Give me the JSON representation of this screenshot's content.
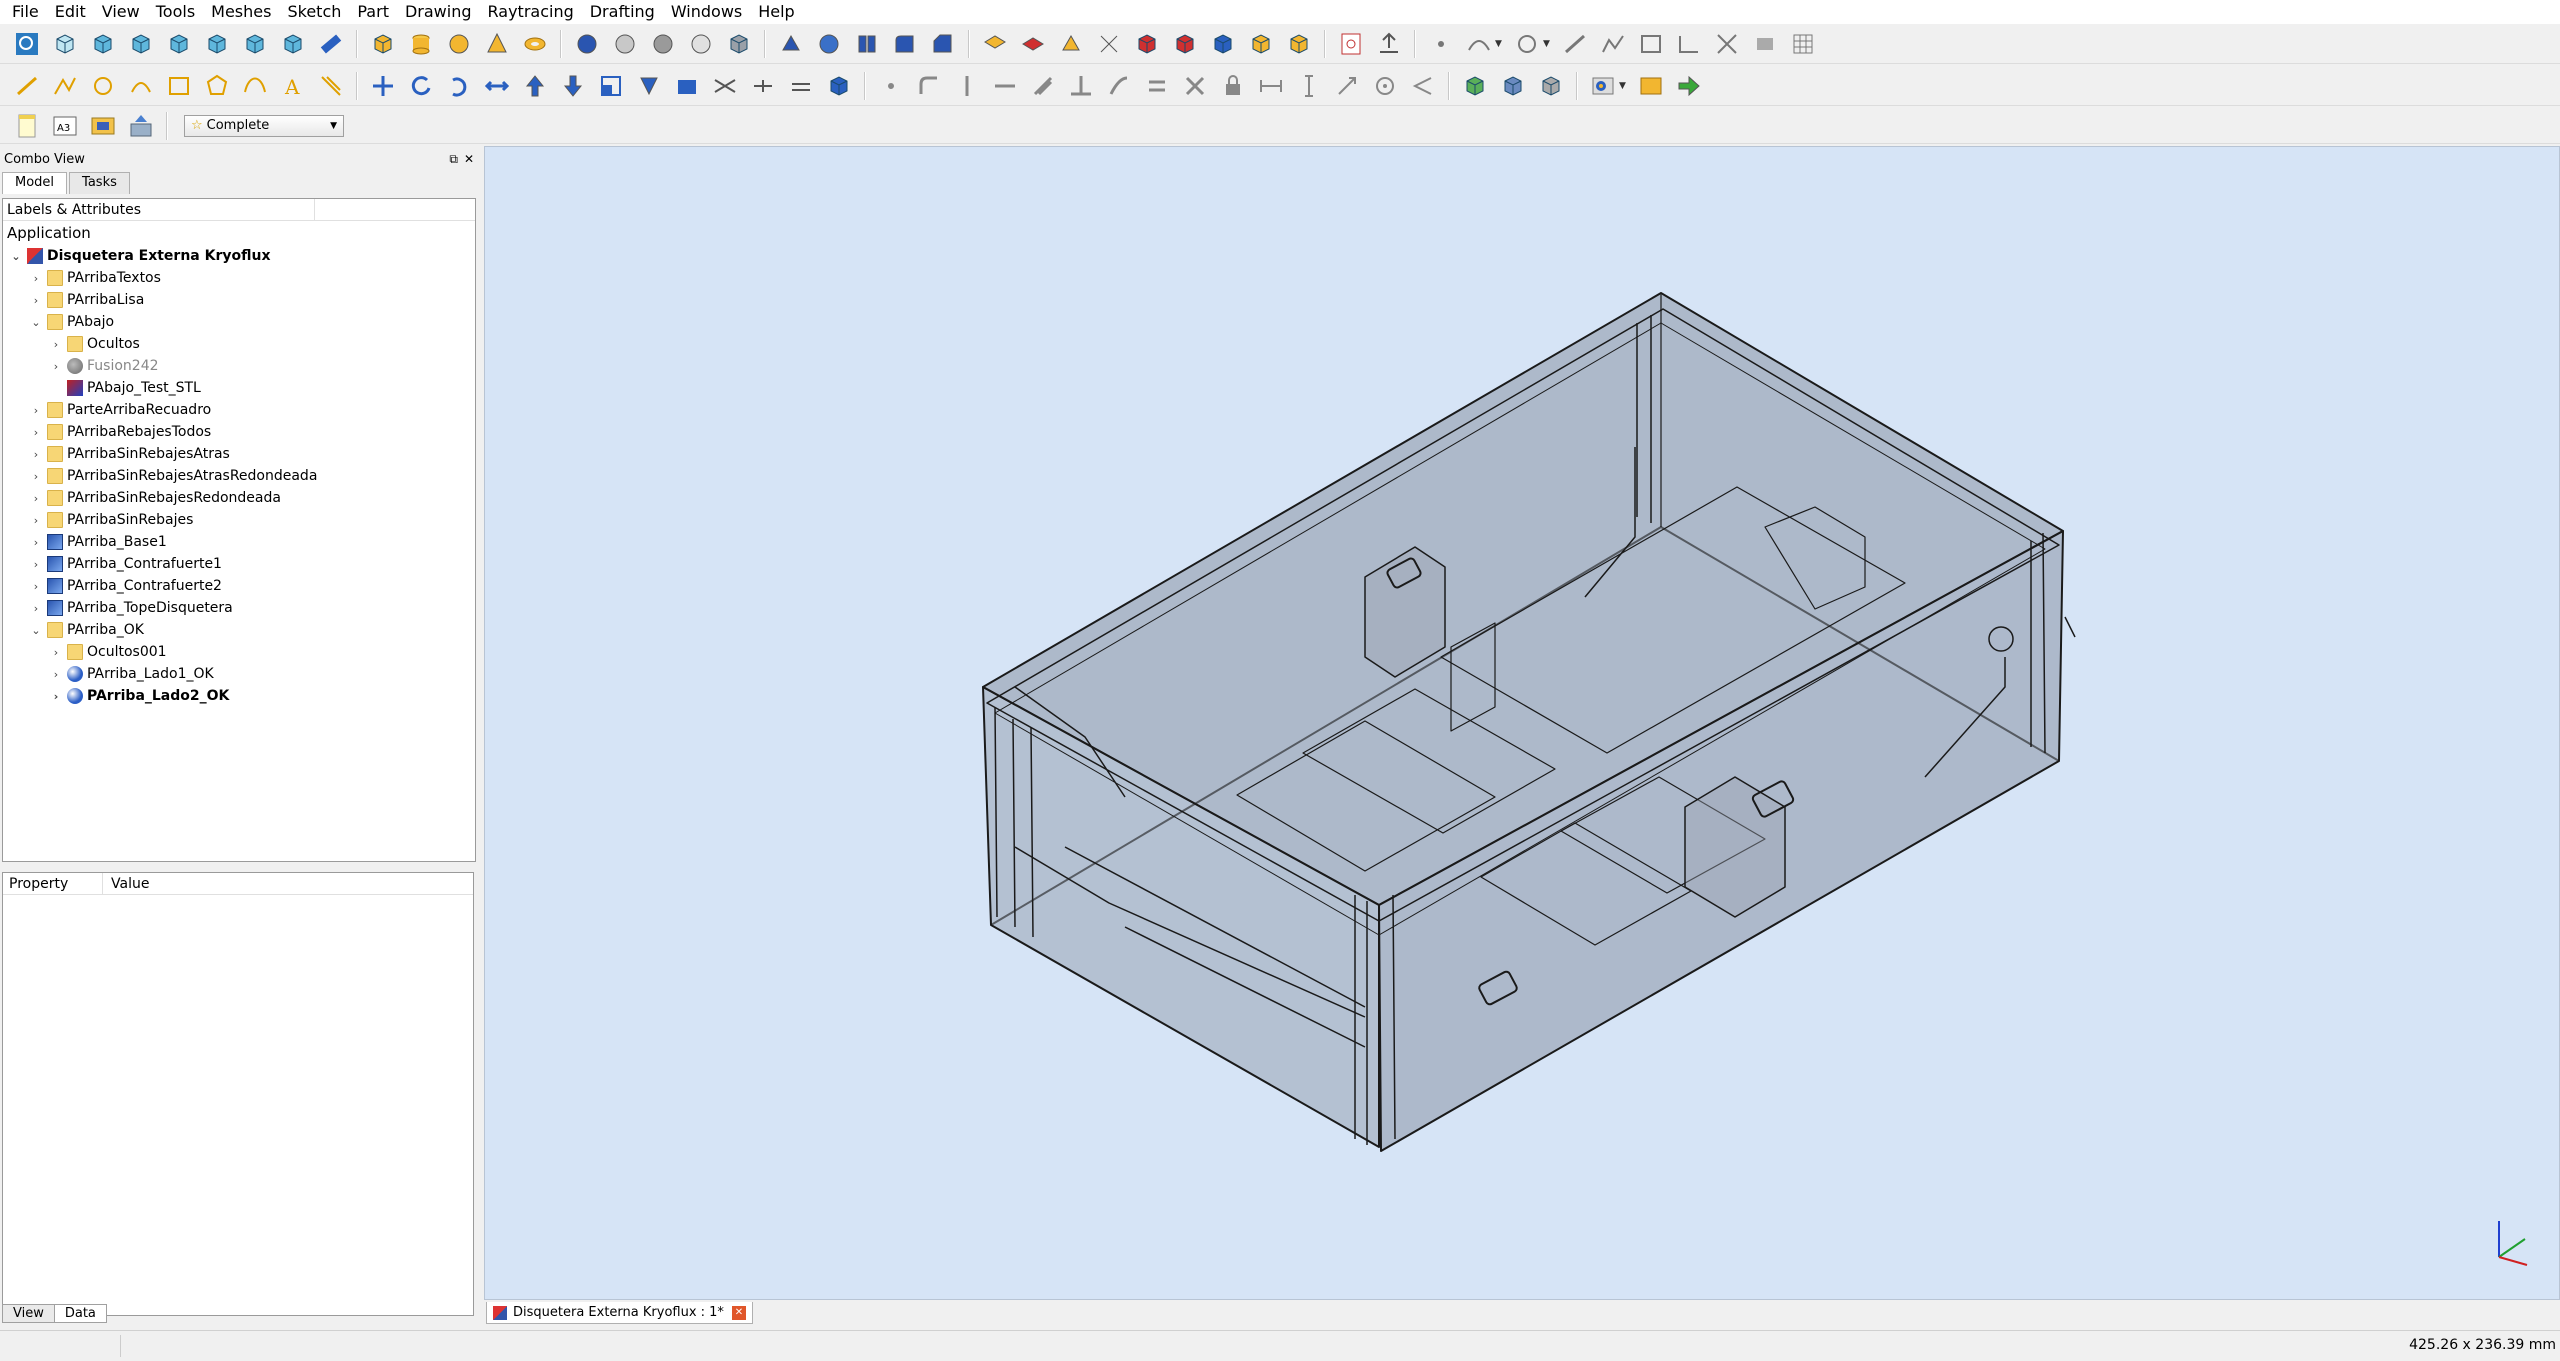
{
  "menu": [
    "File",
    "Edit",
    "View",
    "Tools",
    "Meshes",
    "Sketch",
    "Part",
    "Drawing",
    "Raytracing",
    "Drafting",
    "Windows",
    "Help"
  ],
  "toolbar": {
    "workbench_label": "Complete"
  },
  "combo": {
    "title": "Combo View",
    "tabs": [
      "Model",
      "Tasks"
    ],
    "tree_header": "Labels & Attributes",
    "app_label": "Application",
    "items": [
      {
        "label": "Disquetera Externa Kryoflux",
        "indent": 0,
        "chev": "v",
        "icon": "doc",
        "bold": true
      },
      {
        "label": "PArribaTextos",
        "indent": 1,
        "chev": ">",
        "icon": "folder"
      },
      {
        "label": "PArribaLisa",
        "indent": 1,
        "chev": ">",
        "icon": "folder"
      },
      {
        "label": "PAbajo",
        "indent": 1,
        "chev": "v",
        "icon": "folder"
      },
      {
        "label": "Ocultos",
        "indent": 2,
        "chev": ">",
        "icon": "folder"
      },
      {
        "label": "Fusion242",
        "indent": 2,
        "chev": ">",
        "icon": "fusion",
        "dim": true
      },
      {
        "label": "PAbajo_Test_STL",
        "indent": 2,
        "chev": "",
        "icon": "stl"
      },
      {
        "label": "ParteArribaRecuadro",
        "indent": 1,
        "chev": ">",
        "icon": "folder"
      },
      {
        "label": "PArribaRebajesTodos",
        "indent": 1,
        "chev": ">",
        "icon": "folder"
      },
      {
        "label": "PArribaSinRebajesAtras",
        "indent": 1,
        "chev": ">",
        "icon": "folder"
      },
      {
        "label": "PArribaSinRebajesAtrasRedondeada",
        "indent": 1,
        "chev": ">",
        "icon": "folder"
      },
      {
        "label": "PArribaSinRebajesRedondeada",
        "indent": 1,
        "chev": ">",
        "icon": "folder"
      },
      {
        "label": "PArribaSinRebajes",
        "indent": 1,
        "chev": ">",
        "icon": "folder"
      },
      {
        "label": "PArriba_Base1",
        "indent": 1,
        "chev": ">",
        "icon": "solid"
      },
      {
        "label": "PArriba_Contrafuerte1",
        "indent": 1,
        "chev": ">",
        "icon": "solid"
      },
      {
        "label": "PArriba_Contrafuerte2",
        "indent": 1,
        "chev": ">",
        "icon": "solid"
      },
      {
        "label": "PArriba_TopeDisquetera",
        "indent": 1,
        "chev": ">",
        "icon": "solid"
      },
      {
        "label": "PArriba_OK",
        "indent": 1,
        "chev": "v",
        "icon": "folder"
      },
      {
        "label": "Ocultos001",
        "indent": 2,
        "chev": ">",
        "icon": "folder"
      },
      {
        "label": "PArriba_Lado1_OK",
        "indent": 2,
        "chev": ">",
        "icon": "lado"
      },
      {
        "label": "PArriba_Lado2_OK",
        "indent": 2,
        "chev": ">",
        "icon": "lado",
        "bold": true
      }
    ]
  },
  "properties": {
    "col_property": "Property",
    "col_value": "Value",
    "tabs": [
      "View",
      "Data"
    ]
  },
  "document_tab": "Disquetera Externa Kryoflux : 1*",
  "status": {
    "dimensions": "425.26 x 236.39 mm"
  },
  "colors": {
    "viewport_bg": "#d6e4f6",
    "model_fill": "#8a94a4",
    "folder": "#f7d675",
    "solid": "#2a55b0"
  }
}
